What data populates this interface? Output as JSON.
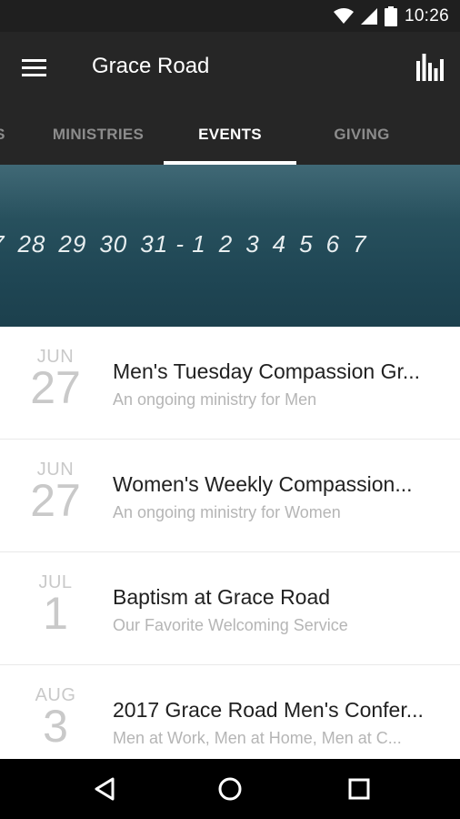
{
  "status_bar": {
    "time": "10:26",
    "icons": [
      "wifi-icon",
      "signal-icon",
      "battery-icon"
    ]
  },
  "app_bar": {
    "title": "Grace Road",
    "menu_icon": "hamburger-menu-icon",
    "action_icon": "bar-chart-icon"
  },
  "tabs": [
    {
      "label": "S",
      "active": false
    },
    {
      "label": "MINISTRIES",
      "active": false
    },
    {
      "label": "EVENTS",
      "active": true
    },
    {
      "label": "GIVING",
      "active": false
    }
  ],
  "hero": {
    "dates": [
      "7",
      "28",
      "29",
      "30",
      "31 - 1",
      "2",
      "3",
      "4",
      "5",
      "6",
      "7"
    ]
  },
  "events": [
    {
      "month": "JUN",
      "day": "27",
      "title": "Men's Tuesday Compassion Gr...",
      "subtitle": "An ongoing ministry for Men"
    },
    {
      "month": "JUN",
      "day": "27",
      "title": "Women's Weekly Compassion...",
      "subtitle": "An ongoing ministry for Women"
    },
    {
      "month": "JUL",
      "day": "1",
      "title": "Baptism at Grace Road",
      "subtitle": "Our Favorite Welcoming Service"
    },
    {
      "month": "AUG",
      "day": "3",
      "title": "2017 Grace Road Men's Confer...",
      "subtitle": "Men at Work, Men at Home, Men at C..."
    }
  ],
  "nav_bar": {
    "buttons": [
      "back-icon",
      "home-icon",
      "recents-icon"
    ]
  },
  "colors": {
    "app_bar": "#262626",
    "status_bar": "#1f1f1f",
    "hero": "#244b59",
    "tab_inactive": "#8c8c8c",
    "date_muted": "#c9c9c9",
    "subtitle": "#b5b5b5"
  }
}
